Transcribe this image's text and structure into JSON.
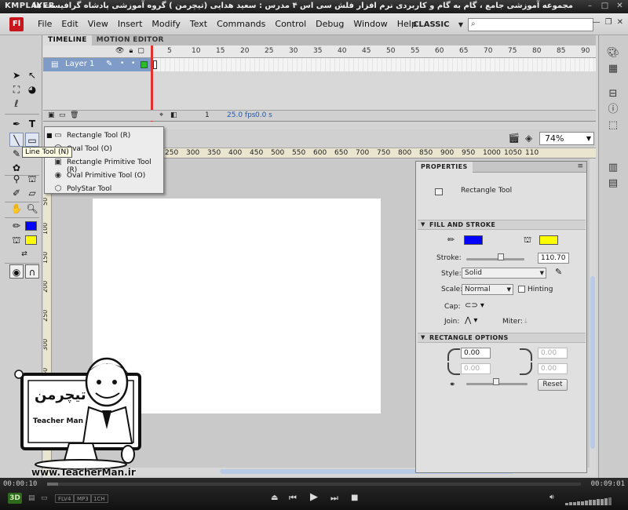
{
  "player": {
    "logo": "KMPLAYER",
    "video_title": "مجموعه آموزشی جامع ، گام به گام و کاربردی نرم افزار فلش سی اس ۴ مدرس : سعید هدایی (تیچرمن ) گروه آموزشی پادشاه گرافیست ها",
    "time_elapsed": "00:00:10",
    "time_total": "00:09:01",
    "progress": 0.02,
    "badge_3d": "3D",
    "tags": [
      "FLV4",
      "MP3",
      "1CH"
    ],
    "volume_level": 0.85
  },
  "app": {
    "logo": "Fl",
    "menus": [
      "File",
      "Edit",
      "View",
      "Insert",
      "Modify",
      "Text",
      "Commands",
      "Control",
      "Debug",
      "Window",
      "Help"
    ],
    "workspace": "CLASSIC",
    "search_placeholder": ""
  },
  "timeline": {
    "tabs": [
      "TIMELINE",
      "MOTION EDITOR"
    ],
    "frame_numbers": [
      "5",
      "10",
      "15",
      "20",
      "25",
      "30",
      "35",
      "40",
      "45",
      "50",
      "55",
      "60",
      "65",
      "70",
      "75",
      "80",
      "85",
      "90"
    ],
    "layer_name": "Layer 1",
    "current_frame": "1",
    "fps": "25.0 fps",
    "elapsed": "0.0 s"
  },
  "tool_flyout": {
    "items": [
      {
        "label": "Rectangle Tool (R)",
        "icon": "rectangle-icon",
        "selected": true
      },
      {
        "label": "Oval Tool (O)",
        "icon": "oval-icon",
        "selected": false
      },
      {
        "label": "Rectangle Primitive Tool (R)",
        "icon": "rectangle-primitive-icon",
        "selected": false
      },
      {
        "label": "Oval Primitive Tool (O)",
        "icon": "oval-primitive-icon",
        "selected": false
      },
      {
        "label": "PolyStar Tool",
        "icon": "polystar-icon",
        "selected": false
      }
    ],
    "tooltip": "Line Tool (N)"
  },
  "stage": {
    "zoom": "74%",
    "ruler_numbers": [
      "250",
      "300",
      "350",
      "400",
      "450",
      "500",
      "550",
      "600",
      "650",
      "700",
      "750",
      "800",
      "850",
      "900",
      "950",
      "1000",
      "1050",
      "110"
    ],
    "vruler_numbers": [
      "50",
      "100",
      "150",
      "200",
      "250",
      "300",
      "350"
    ]
  },
  "properties": {
    "tab": "PROPERTIES",
    "tool_name": "Rectangle Tool",
    "sections": {
      "fill_stroke": "FILL AND STROKE",
      "rect_options": "RECTANGLE OPTIONS"
    },
    "stroke_label": "Stroke:",
    "stroke_value": "110.70",
    "style_label": "Style:",
    "style_value": "Solid",
    "scale_label": "Scale:",
    "scale_value": "Normal",
    "hinting_label": "Hinting",
    "cap_label": "Cap:",
    "join_label": "Join:",
    "miter_label": "Miter:",
    "corner_values": [
      "0.00",
      "0.00",
      "0.00",
      "0.00"
    ],
    "reset_label": "Reset",
    "stroke_color": "#0000ff",
    "fill_color": "#ffff00"
  },
  "colors": {
    "stroke": "#0000ff",
    "fill": "#ffff00"
  },
  "watermark": {
    "brand_fa": "تیچرمن",
    "brand_en": "Teacher Man",
    "url": "www.TeacherMan.ir"
  }
}
